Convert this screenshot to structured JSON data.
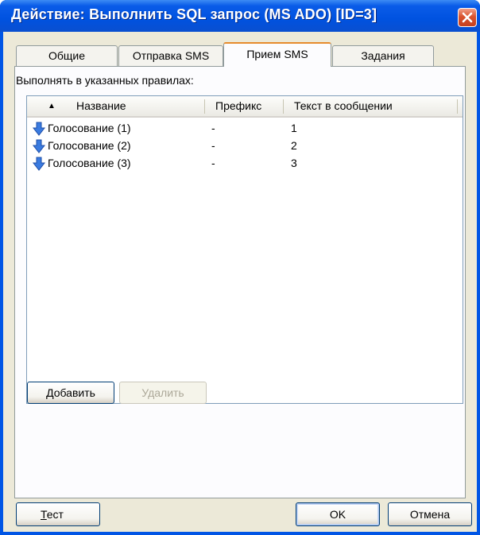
{
  "window": {
    "title": "Действие: Выполнить SQL запрос (MS ADO) [ID=3]"
  },
  "tabs": [
    {
      "label": "Общие",
      "active": false
    },
    {
      "label": "Отправка SMS",
      "active": false
    },
    {
      "label": "Прием SMS",
      "active": true
    },
    {
      "label": "Задания",
      "active": false
    }
  ],
  "panel": {
    "label": "Выполнять в указанных правилах:",
    "list": {
      "sort_indicator": "▲",
      "columns": [
        "Название",
        "Префикс",
        "Текст в сообщении"
      ],
      "rows": [
        {
          "name": "Голосование (1)",
          "prefix": "-",
          "text": "1",
          "icon": "arrow-down-icon"
        },
        {
          "name": "Голосование (2)",
          "prefix": "-",
          "text": "2",
          "icon": "arrow-down-icon"
        },
        {
          "name": "Голосование (3)",
          "prefix": "-",
          "text": "3",
          "icon": "arrow-down-icon"
        }
      ]
    },
    "add_label": "Добавить",
    "delete_label": "Удалить"
  },
  "footer": {
    "test_label_accel": "Т",
    "test_label_rest": "ест",
    "ok_label": "OK",
    "cancel_label": "Отмена"
  },
  "colors": {
    "titlebar": "#0052e0",
    "active_tab_accent": "#e68b2c",
    "dialog_face": "#ece9d8",
    "row_icon": "#3a7be0"
  }
}
